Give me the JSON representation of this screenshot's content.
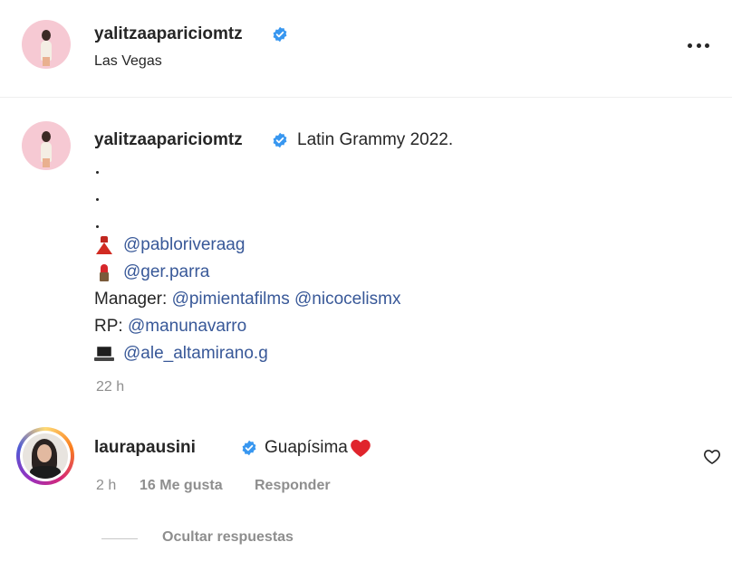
{
  "header": {
    "username": "yalitzaapariciomtz",
    "location": "Las Vegas",
    "more_icon": "more-horizontal-icon"
  },
  "caption": {
    "username": "yalitzaapariciomtz",
    "text": "Latin Grammy 2022.",
    "lines": [
      {
        "emoji": "dress",
        "prefix": "",
        "mentions": [
          "@pabloriveraag"
        ]
      },
      {
        "emoji": "lipstick",
        "prefix": "",
        "mentions": [
          "@ger.parra"
        ]
      },
      {
        "emoji": "",
        "prefix": "Manager:",
        "mentions": [
          "@pimientafilms",
          "@nicocelismx"
        ]
      },
      {
        "emoji": "",
        "prefix": "RP:",
        "mentions": [
          "@manunavarro"
        ]
      },
      {
        "emoji": "laptop",
        "prefix": "",
        "mentions": [
          "@ale_altamirano.g"
        ]
      }
    ],
    "time": "22 h"
  },
  "comment": {
    "username": "laurapausini",
    "text": "Guapísima",
    "emoji": "red-heart",
    "time": "2 h",
    "likes": "16 Me gusta",
    "reply": "Responder",
    "hide_replies": "Ocultar respuestas"
  },
  "colors": {
    "mention": "#385898",
    "verified": "#3897f0",
    "muted": "#8e8e8e"
  }
}
